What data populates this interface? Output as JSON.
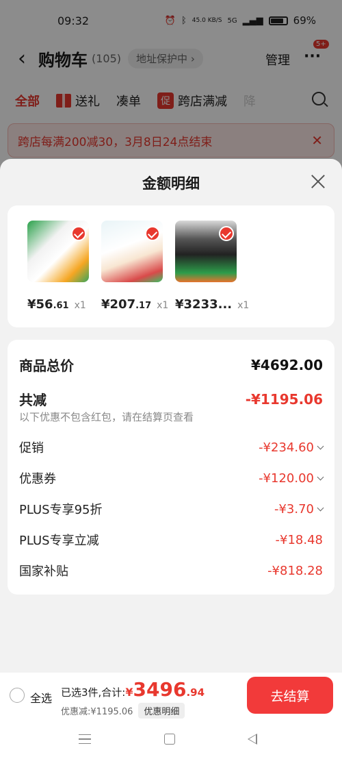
{
  "status_bar": {
    "time": "09:32",
    "net_speed": "45.0 KB/S",
    "signal": "5G",
    "battery": "69%"
  },
  "header": {
    "title": "购物车",
    "count": "(105)",
    "address": "地址保护中",
    "manage": "管理",
    "badge": "5+"
  },
  "tabs": [
    {
      "label": "全部"
    },
    {
      "label": "送礼"
    },
    {
      "label": "凑单"
    },
    {
      "label": "跨店满减",
      "tag": "促"
    },
    {
      "label": "降"
    }
  ],
  "banner": {
    "text": "跨店每满200减30，3月8日24点结束"
  },
  "sheet": {
    "title": "金额明细",
    "products": [
      {
        "price_int": "¥56",
        "price_cents": ".61",
        "qty": "x1"
      },
      {
        "price_int": "¥207",
        "price_cents": ".17",
        "qty": "x1"
      },
      {
        "price_int": "¥3233...",
        "price_cents": "",
        "qty": "x1"
      }
    ],
    "summary": {
      "total_label": "商品总价",
      "total_value": "¥4692.00",
      "reduce_label": "共减",
      "reduce_value": "-¥1195.06",
      "note": "以下优惠不包含红包，请在结算页查看",
      "items": [
        {
          "label": "促销",
          "value": "-¥234.60"
        },
        {
          "label": "优惠券",
          "value": "-¥120.00"
        },
        {
          "label": "PLUS专享95折",
          "value": "-¥3.70"
        },
        {
          "label": "PLUS专享立减",
          "value": "-¥18.48"
        },
        {
          "label": "国家补贴",
          "value": "-¥818.28"
        }
      ]
    }
  },
  "bottom_bar": {
    "select_all": "全选",
    "selected": "已选3件,合计:",
    "yen": "¥",
    "total_int": "3496",
    "total_cents": ".94",
    "discount": "优惠减:¥1195.06",
    "detail": "优惠明细",
    "checkout": "去结算"
  },
  "colors": {
    "accent": "#e8382e",
    "checkout": "#f23a3a"
  }
}
